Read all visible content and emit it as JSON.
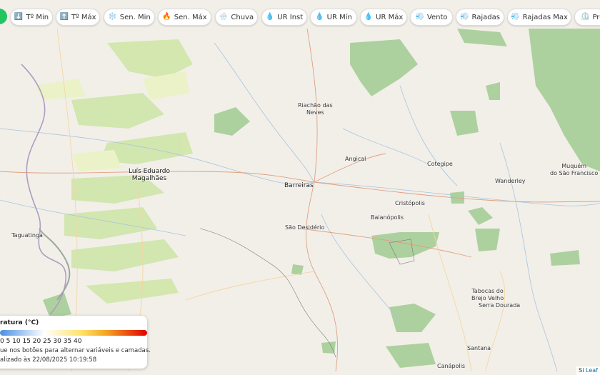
{
  "toolbar": {
    "buttons": [
      {
        "label": "Tº Min",
        "icon": "⬇️"
      },
      {
        "label": "Tº Máx",
        "icon": "⬆️"
      },
      {
        "label": "Sen. Min",
        "icon": "❄️"
      },
      {
        "label": "Sen. Máx",
        "icon": "🔥"
      },
      {
        "label": "Chuva",
        "icon": "🌧️"
      },
      {
        "label": "UR Inst",
        "icon": "💧"
      },
      {
        "label": "UR Mín",
        "icon": "💧"
      },
      {
        "label": "UR Máx",
        "icon": "💧"
      },
      {
        "label": "Vento",
        "icon": "💨"
      },
      {
        "label": "Rajadas",
        "icon": "💨"
      },
      {
        "label": "Rajadas Max",
        "icon": "💨"
      },
      {
        "label": "Pre",
        "icon": "⏲️"
      }
    ]
  },
  "places": {
    "riachao": "Riachão das\nNeves",
    "angical": "Angical",
    "cotegipe": "Cotegipe",
    "wanderley": "Wanderley",
    "muquem": "Muquém\ndo São Francisco",
    "luis": "Luís Eduardo\nMagalhães",
    "barreiras": "Barreiras",
    "cristopolis": "Cristópolis",
    "baianopolis": "Baianópolis",
    "sao_desiderio": "São Desidério",
    "taguatinga": "Taguatinga",
    "tabocas": "Tabocas do\nBrejo Velho",
    "serra_dourada": "Serra Dourada",
    "santana": "Santana",
    "canapolis": "Canápolis"
  },
  "legend": {
    "title": "ratura (°C)",
    "ticks": "0 5 10 15 20 25 30 35 40",
    "hint": "ue nos botões para alternar variáveis e camadas.",
    "updated": "alizado às 22/08/2025 10:19:58"
  },
  "attribution": {
    "prefix": "Si",
    "link": "Leaf"
  }
}
